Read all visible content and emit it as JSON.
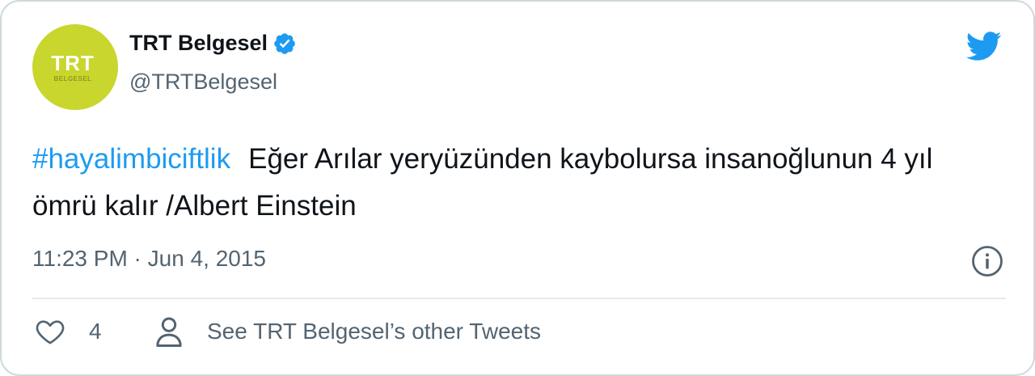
{
  "account": {
    "name": "TRT Belgesel",
    "handle": "@TRTBelgesel",
    "avatar_text": "TRT",
    "avatar_subtext": "BELGESEL",
    "avatar_color": "#c8d62d",
    "verified": true
  },
  "tweet": {
    "hashtag": "#hayalimbiciftlik",
    "body": "Eğer Arılar yeryüzünden kaybolursa insanoğlunun 4 yıl ömrü kalır /Albert Einstein",
    "timestamp": "11:23 PM · Jun 4, 2015"
  },
  "actions": {
    "like_count": "4",
    "other_tweets_label": "See TRT Belgesel’s other Tweets"
  },
  "colors": {
    "accent": "#1d9bf0",
    "text": "#0f1419",
    "muted": "#536471",
    "border": "#cfd9de"
  },
  "icons": [
    "verified-badge-icon",
    "twitter-bird-icon",
    "info-icon",
    "heart-icon",
    "person-icon"
  ]
}
